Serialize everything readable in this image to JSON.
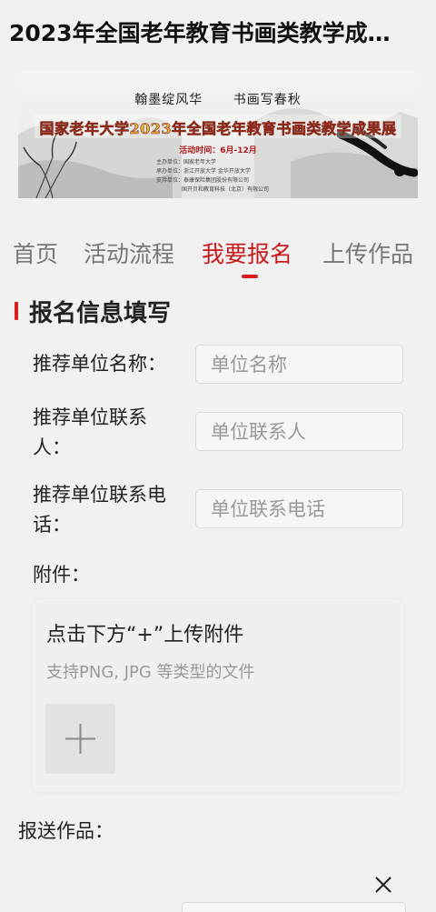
{
  "header": {
    "title": "2023年全国老年教育书画类教学成…"
  },
  "banner": {
    "slogan_left": "翰墨绽风华",
    "slogan_right": "书画写春秋",
    "title": "国家老年大学2023年全国老年教育书画类教学成果展",
    "time": "活动时间：6月-12月",
    "orgs": [
      "主办单位：国家老年大学",
      "承办单位：浙江开放大学 金华开放大学",
      "支持单位：泰康保险集团股份有限公司",
      "国开贝和教育科技（北京）有限公司"
    ]
  },
  "tabs": [
    {
      "label": "首页",
      "active": false
    },
    {
      "label": "活动流程",
      "active": false
    },
    {
      "label": "我要报名",
      "active": true
    },
    {
      "label": "上传作品",
      "active": false
    }
  ],
  "section": {
    "title": "报名信息填写"
  },
  "form": {
    "unit_name": {
      "label": "推荐单位名称：",
      "placeholder": "单位名称",
      "value": ""
    },
    "unit_contact": {
      "label_line1": "推荐单位联系",
      "label_line2": "人：",
      "placeholder": "单位联系人",
      "value": ""
    },
    "unit_phone": {
      "label_line1": "推荐单位联系电",
      "label_line2": "话：",
      "placeholder": "单位联系电话",
      "value": ""
    },
    "attachment": {
      "label": "附件：",
      "upload_title": "点击下方“+”上传附件",
      "upload_hint": "支持PNG, JPG 等类型的文件"
    },
    "submit_works": {
      "label": "报送作品："
    }
  },
  "colors": {
    "accent": "#d81e1e",
    "background": "#f1f1f1"
  },
  "icons": {
    "plus": "plus-icon",
    "close": "close-icon"
  }
}
